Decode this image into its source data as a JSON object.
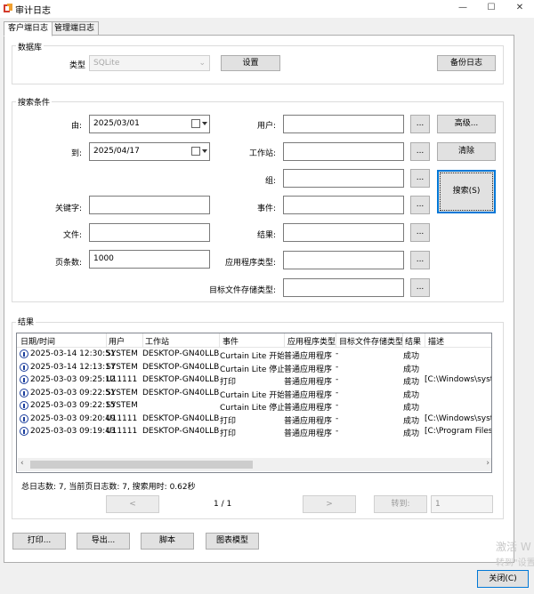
{
  "window": {
    "title": "审计日志",
    "minimize": "—",
    "maximize": "☐",
    "close": "✕"
  },
  "tabs": [
    {
      "label": "客户端日志",
      "active": true
    },
    {
      "label": "管理端日志",
      "active": false
    }
  ],
  "database": {
    "group_title": "数据库",
    "type_label": "类型",
    "type_value": "SQLite",
    "settings_button": "设置",
    "backup_button": "备份日志"
  },
  "search": {
    "group_title": "搜索条件",
    "from_label": "由:",
    "from_value": "2025/03/01",
    "to_label": "到:",
    "to_value": "2025/04/17",
    "user_label": "用户:",
    "workstation_label": "工作站:",
    "group_label": "组:",
    "keyword_label": "关键字:",
    "event_label": "事件:",
    "file_label": "文件:",
    "result_label": "结果:",
    "page_size_label": "页条数:",
    "page_size_value": "1000",
    "app_type_label": "应用程序类型:",
    "target_storage_label": "目标文件存储类型:",
    "browse": "...",
    "advanced_button": "高级...",
    "clear_button": "清除",
    "search_button": "搜索(S)"
  },
  "results": {
    "group_title": "结果",
    "columns": [
      "日期/时间",
      "用户",
      "工作站",
      "事件",
      "应用程序类型",
      "目标文件存储类型",
      "结果",
      "描述"
    ],
    "rows": [
      [
        "2025-03-14 12:30:51",
        "SYSTEM",
        "DESKTOP-GN40LLB",
        "Curtain Lite 开始",
        "普通应用程序",
        "-",
        "成功",
        ""
      ],
      [
        "2025-03-14 12:13:17",
        "SYSTEM",
        "DESKTOP-GN40LLB",
        "Curtain Lite 停止",
        "普通应用程序",
        "-",
        "成功",
        ""
      ],
      [
        "2025-03-03 09:25:12",
        "U11111",
        "DESKTOP-GN40LLB",
        "打印",
        "普通应用程序",
        "-",
        "成功",
        "[C:\\Windows\\syster"
      ],
      [
        "2025-03-03 09:22:51",
        "SYSTEM",
        "DESKTOP-GN40LLB",
        "Curtain Lite 开始",
        "普通应用程序",
        "-",
        "成功",
        ""
      ],
      [
        "2025-03-03 09:22:15",
        "SYSTEM",
        "",
        "Curtain Lite 停止",
        "普通应用程序",
        "-",
        "成功",
        ""
      ],
      [
        "2025-03-03 09:20:49",
        "U11111",
        "DESKTOP-GN40LLB",
        "打印",
        "普通应用程序",
        "-",
        "成功",
        "[C:\\Windows\\syster"
      ],
      [
        "2025-03-03 09:19:43",
        "U11111",
        "DESKTOP-GN40LLB",
        "打印",
        "普通应用程序",
        "-",
        "成功",
        "[C:\\Program Files ("
      ]
    ],
    "summary": "总日志数: 7, 当前页日志数: 7, 搜索用时: 0.62秒",
    "prev_button": "<",
    "next_button": ">",
    "page_indicator": "1  /  1",
    "goto_button": "转到:",
    "goto_value": "1"
  },
  "bottom_buttons": {
    "print": "打印...",
    "export": "导出...",
    "script": "脚本",
    "chart_template": "图表模型"
  },
  "close_button": "关闭(C)",
  "watermark": {
    "line1": "激活 W",
    "line2": "转到\"设置"
  }
}
